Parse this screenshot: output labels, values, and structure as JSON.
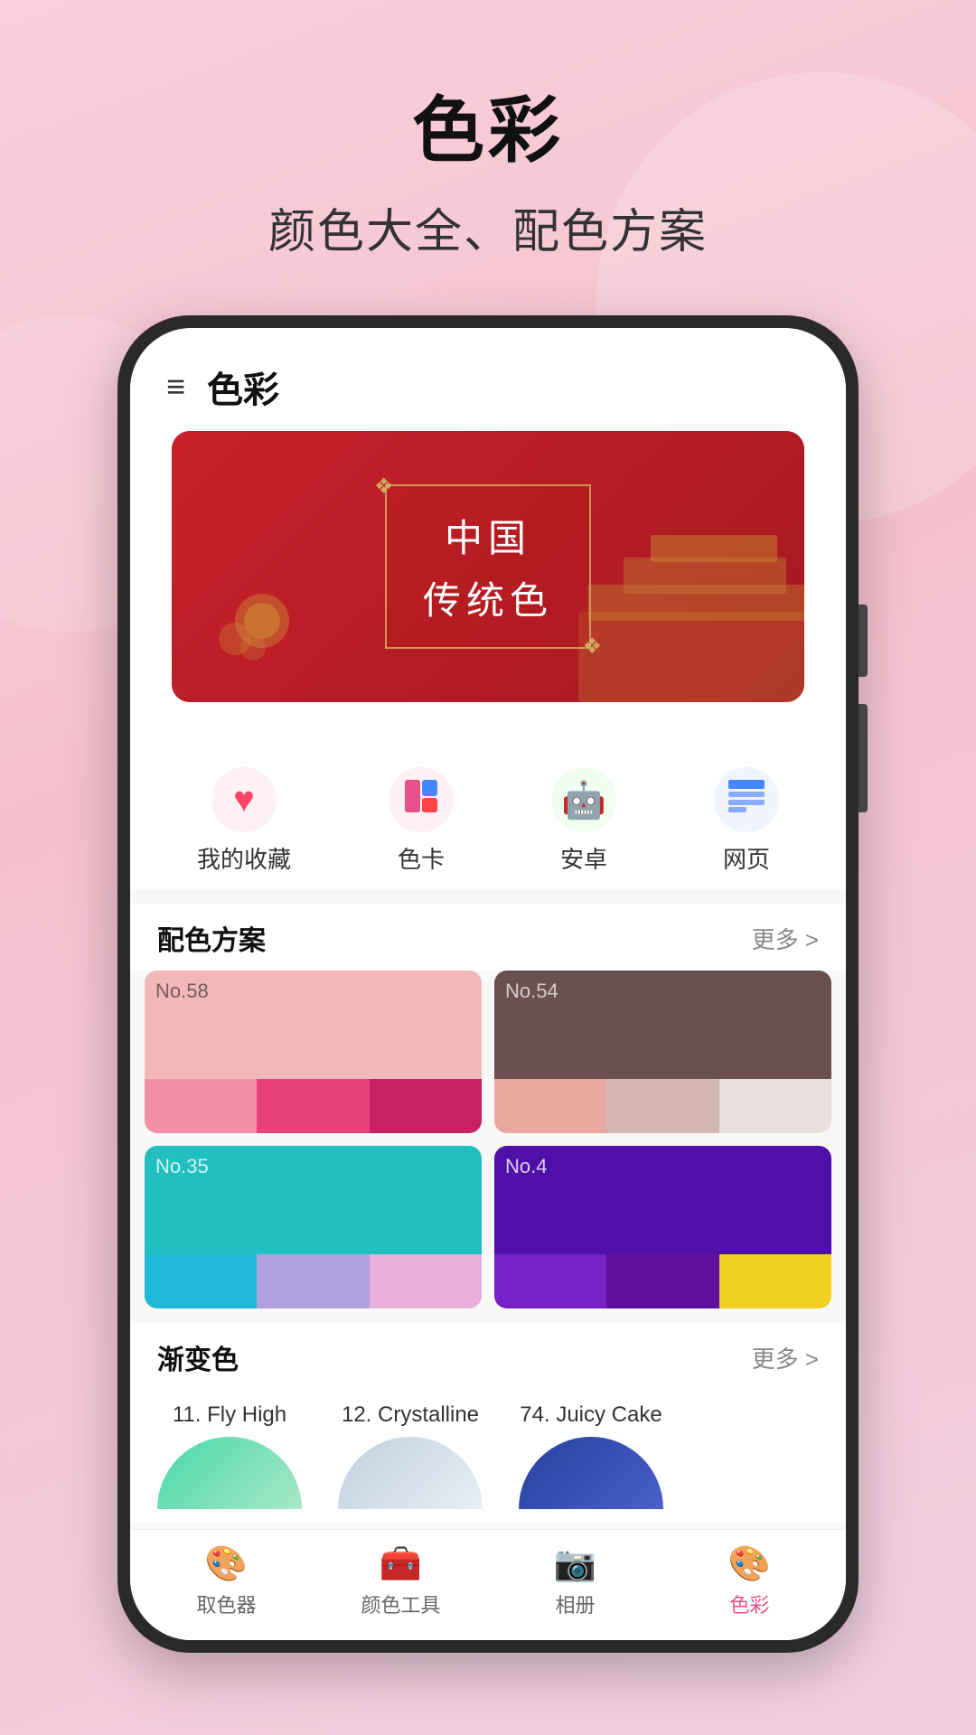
{
  "page": {
    "title": "色彩",
    "subtitle": "颜色大全、配色方案"
  },
  "app": {
    "title": "色彩",
    "menuIcon": "≡"
  },
  "banner": {
    "title": "中国",
    "subtitle": "传统色",
    "dots": [
      true,
      false
    ]
  },
  "iconGrid": [
    {
      "icon": "♥",
      "label": "我的收藏",
      "color": "#ff4466"
    },
    {
      "icon": "🎨",
      "label": "色卡",
      "color": "#e8508a"
    },
    {
      "icon": "🤖",
      "label": "安卓",
      "color": "#4caf50"
    },
    {
      "icon": "📄",
      "label": "网页",
      "color": "#4488ff"
    }
  ],
  "sections": {
    "palette": {
      "title": "配色方案",
      "more": "更多 >"
    },
    "gradient": {
      "title": "渐变色",
      "more": "更多 >"
    }
  },
  "palettes": [
    {
      "no": "No.58",
      "mainColor": "#f2b8b8",
      "swatches": [
        "#f48faa",
        "#e8417a",
        "#c82060"
      ]
    },
    {
      "no": "No.54",
      "mainColor": "#6b5050",
      "swatches": [
        "#e8a8a0",
        "#d4b8b0",
        "#e8e0dc"
      ]
    },
    {
      "no": "No.35",
      "mainColor": "#20c0c0",
      "swatches": [
        "#20b8d8",
        "#b0a0e0",
        "#e8b0d8"
      ]
    },
    {
      "no": "No.4",
      "mainColor": "#5010a8",
      "swatches": [
        "#7820c8",
        "#6010a0",
        "#f0d020"
      ]
    }
  ],
  "gradients": [
    {
      "title": "11. Fly High",
      "colorStart": "#48d8a8",
      "colorEnd": "#a8e8c8"
    },
    {
      "title": "12. Crystalline",
      "colorStart": "#c0d0e0",
      "colorEnd": "#e8eef4"
    },
    {
      "title": "74. Juicy Cake",
      "colorStart": "#2840a0",
      "colorEnd": "#4860c8"
    }
  ],
  "bottomNav": [
    {
      "icon": "🎨",
      "label": "取色器",
      "active": false
    },
    {
      "icon": "🧰",
      "label": "颜色工具",
      "active": false
    },
    {
      "icon": "📷",
      "label": "相册",
      "active": false
    },
    {
      "icon": "🎨",
      "label": "色彩",
      "active": true
    }
  ]
}
